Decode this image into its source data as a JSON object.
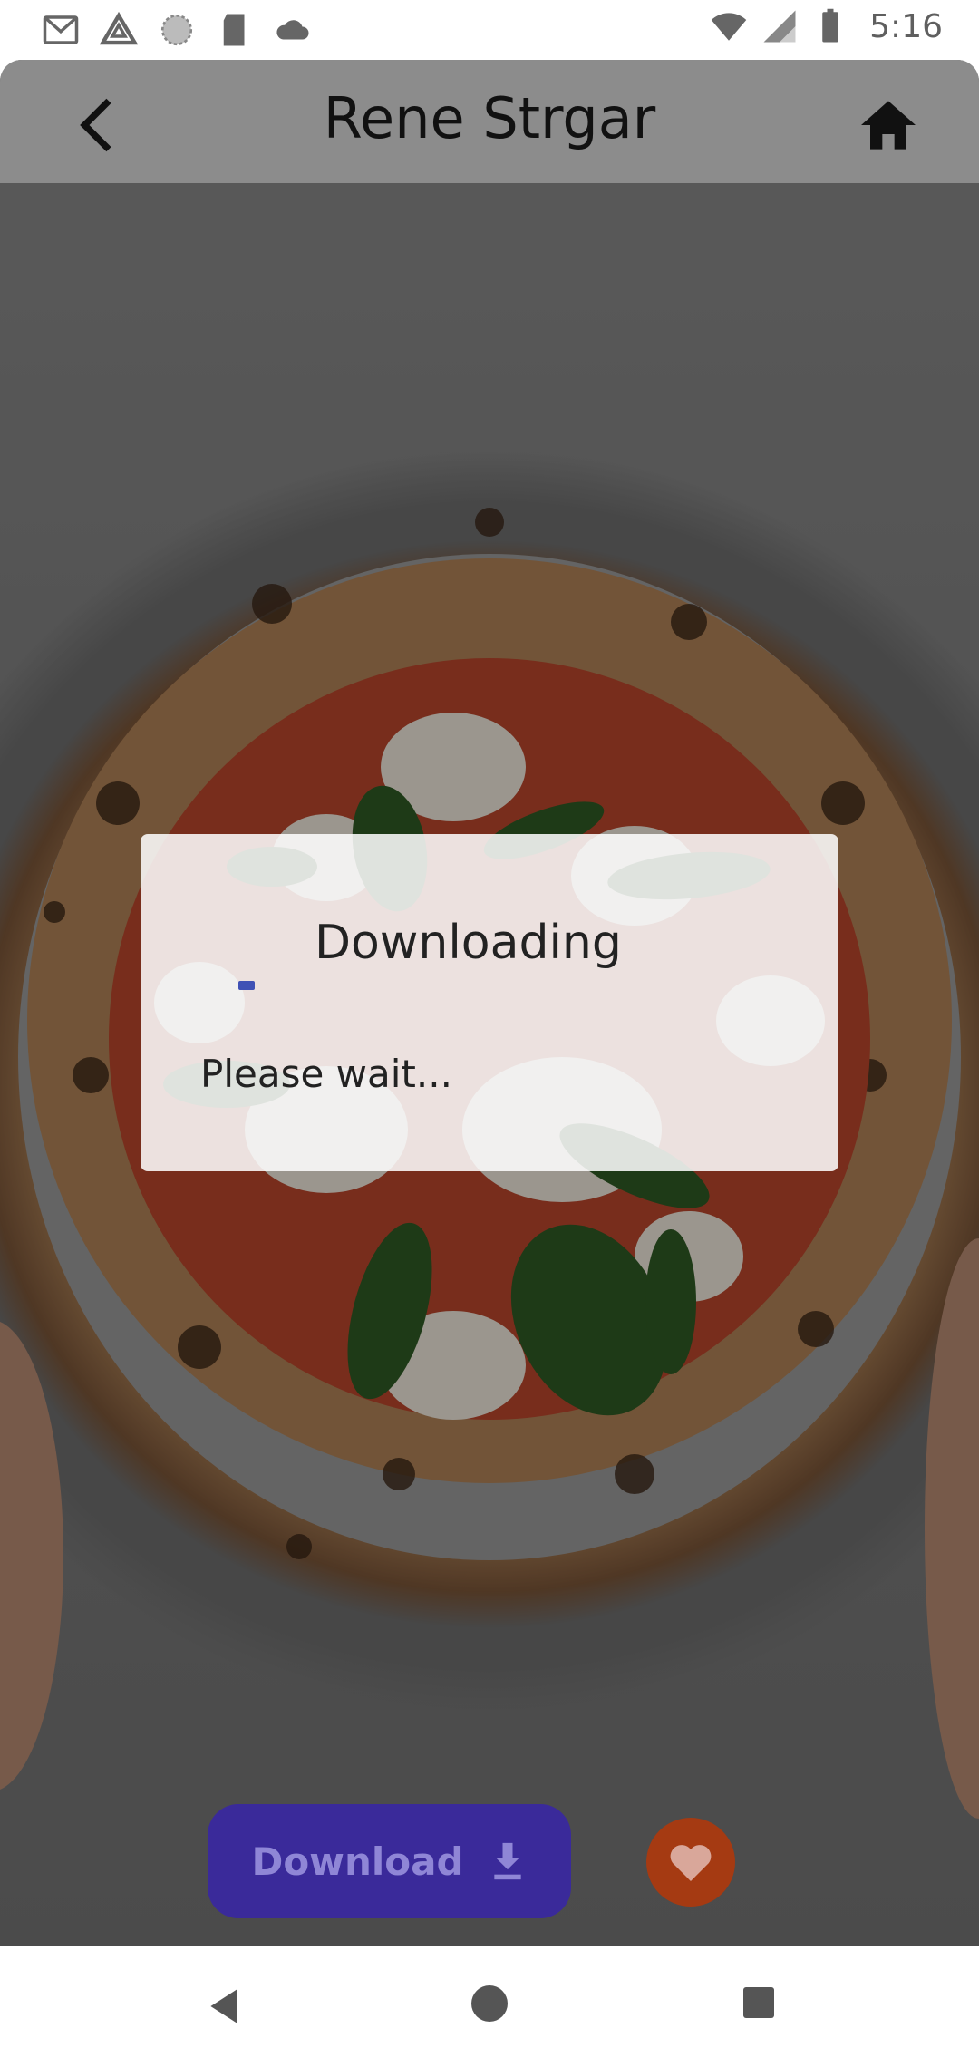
{
  "status_bar": {
    "time": "5:16",
    "left_icons": [
      "gmail-icon",
      "drive-icon",
      "circle-icon",
      "sd-card-icon",
      "cloud-icon"
    ],
    "right_icons": [
      "wifi-icon",
      "signal-icon",
      "battery-icon"
    ]
  },
  "app_bar": {
    "title": "Rene Strgar",
    "back_icon": "arrow-back-icon",
    "home_icon": "home-icon"
  },
  "dialog": {
    "title": "Downloading",
    "message": "Please wait..."
  },
  "actions": {
    "download_label": "Download",
    "download_icon": "download-icon",
    "favorite_icon": "heart-icon"
  },
  "colors": {
    "download_button": "#3a2a9a",
    "favorite_button": "#a53a12",
    "spinner": "#3f51b5"
  }
}
